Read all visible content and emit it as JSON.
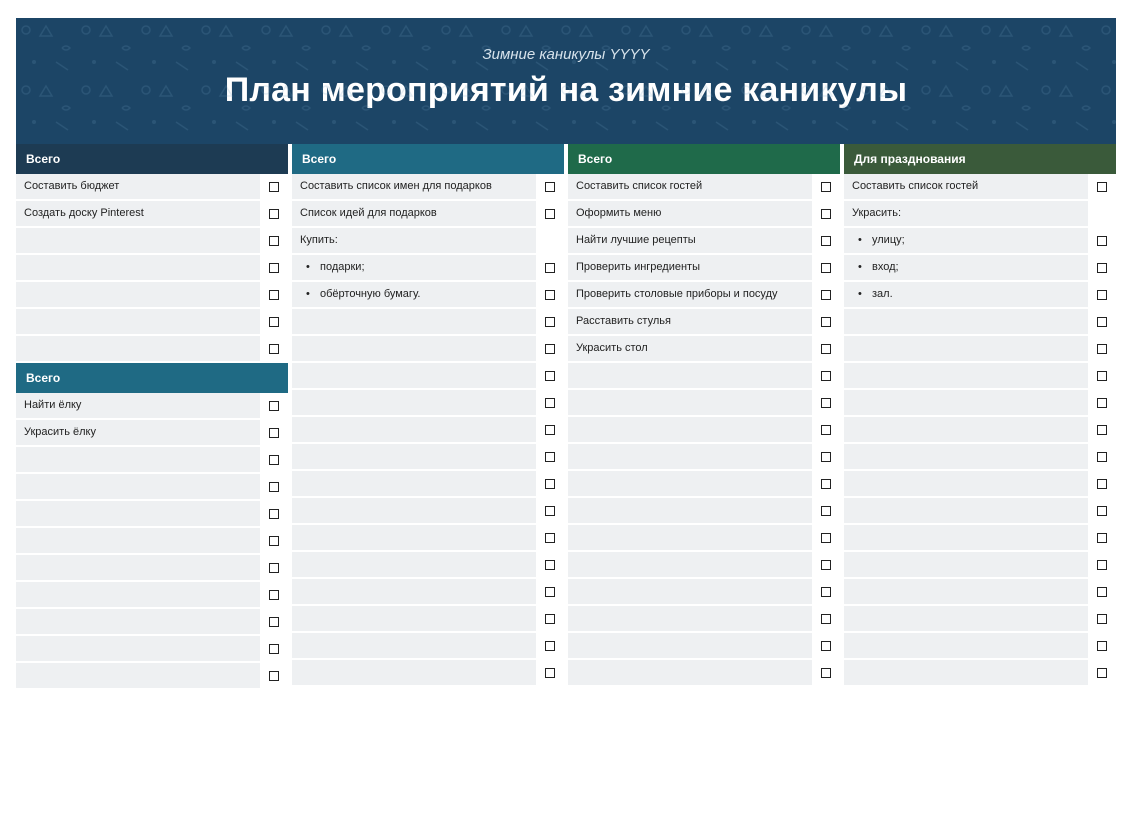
{
  "header": {
    "subtitle": "Зимние каникулы YYYY",
    "title": "План мероприятий на зимние каникулы"
  },
  "col1a": {
    "head": "Всего",
    "rows": [
      {
        "text": "Составить бюджет",
        "check": true
      },
      {
        "text": "Создать доску Pinterest",
        "check": true
      },
      {
        "text": "",
        "check": true
      },
      {
        "text": "",
        "check": true
      },
      {
        "text": "",
        "check": true
      },
      {
        "text": "",
        "check": true
      },
      {
        "text": "",
        "check": true
      }
    ]
  },
  "col1b": {
    "head": "Всего",
    "rows": [
      {
        "text": "Найти ёлку",
        "check": true
      },
      {
        "text": "Украсить ёлку",
        "check": true
      },
      {
        "text": "",
        "check": true
      },
      {
        "text": "",
        "check": true
      },
      {
        "text": "",
        "check": true
      },
      {
        "text": "",
        "check": true
      },
      {
        "text": "",
        "check": true
      },
      {
        "text": "",
        "check": true
      },
      {
        "text": "",
        "check": true
      },
      {
        "text": "",
        "check": true
      },
      {
        "text": "",
        "check": true
      }
    ]
  },
  "col2": {
    "head": "Всего",
    "rows": [
      {
        "text": "Составить список имен для подарков",
        "check": true
      },
      {
        "text": "Список идей для подарков",
        "check": true
      },
      {
        "text": "Купить:",
        "check": false
      },
      {
        "text": "подарки;",
        "check": true,
        "bullet": true
      },
      {
        "text": "обёрточную бумагу.",
        "check": true,
        "bullet": true
      },
      {
        "text": "",
        "check": true
      },
      {
        "text": "",
        "check": true
      },
      {
        "text": "",
        "check": true
      },
      {
        "text": "",
        "check": true
      },
      {
        "text": "",
        "check": true
      },
      {
        "text": "",
        "check": true
      },
      {
        "text": "",
        "check": true
      },
      {
        "text": "",
        "check": true
      },
      {
        "text": "",
        "check": true
      },
      {
        "text": "",
        "check": true
      },
      {
        "text": "",
        "check": true
      },
      {
        "text": "",
        "check": true
      },
      {
        "text": "",
        "check": true
      },
      {
        "text": "",
        "check": true
      }
    ]
  },
  "col3": {
    "head": "Всего",
    "rows": [
      {
        "text": "Составить список гостей",
        "check": true
      },
      {
        "text": "Оформить меню",
        "check": true
      },
      {
        "text": "Найти лучшие рецепты",
        "check": true
      },
      {
        "text": "Проверить ингредиенты",
        "check": true
      },
      {
        "text": "Проверить столовые приборы и посуду",
        "check": true
      },
      {
        "text": "Расставить стулья",
        "check": true
      },
      {
        "text": "Украсить стол",
        "check": true
      },
      {
        "text": "",
        "check": true
      },
      {
        "text": "",
        "check": true
      },
      {
        "text": "",
        "check": true
      },
      {
        "text": "",
        "check": true
      },
      {
        "text": "",
        "check": true
      },
      {
        "text": "",
        "check": true
      },
      {
        "text": "",
        "check": true
      },
      {
        "text": "",
        "check": true
      },
      {
        "text": "",
        "check": true
      },
      {
        "text": "",
        "check": true
      },
      {
        "text": "",
        "check": true
      },
      {
        "text": "",
        "check": true
      }
    ]
  },
  "col4": {
    "head": "Для празднования",
    "rows": [
      {
        "text": "Составить список гостей",
        "check": true
      },
      {
        "text": "Украсить:",
        "check": false
      },
      {
        "text": "улицу;",
        "check": true,
        "bullet": true
      },
      {
        "text": "вход;",
        "check": true,
        "bullet": true
      },
      {
        "text": "зал.",
        "check": true,
        "bullet": true
      },
      {
        "text": "",
        "check": true
      },
      {
        "text": "",
        "check": true
      },
      {
        "text": "",
        "check": true
      },
      {
        "text": "",
        "check": true
      },
      {
        "text": "",
        "check": true
      },
      {
        "text": "",
        "check": true
      },
      {
        "text": "",
        "check": true
      },
      {
        "text": "",
        "check": true
      },
      {
        "text": "",
        "check": true
      },
      {
        "text": "",
        "check": true
      },
      {
        "text": "",
        "check": true
      },
      {
        "text": "",
        "check": true
      },
      {
        "text": "",
        "check": true
      },
      {
        "text": "",
        "check": true
      }
    ]
  }
}
